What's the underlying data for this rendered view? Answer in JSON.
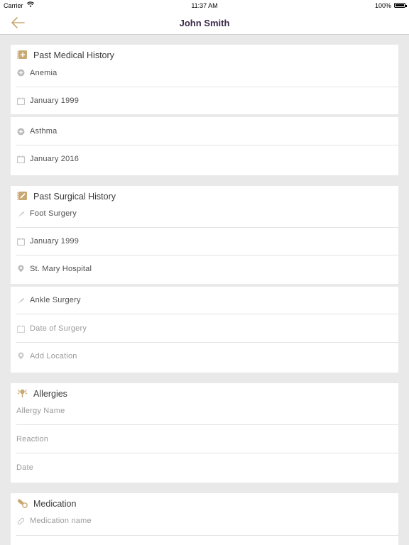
{
  "status_bar": {
    "carrier": "Carrier",
    "time": "11:37 AM",
    "battery": "100%"
  },
  "nav": {
    "title": "John Smith",
    "back_icon": "arrow-left-icon"
  },
  "colors": {
    "accent": "#c8a873",
    "title": "#3b2a4b",
    "background": "#e9e9e9"
  },
  "medical": {
    "title": "Past Medical History",
    "entries": [
      {
        "condition": "Anemia",
        "date": "January 1999"
      },
      {
        "condition": "Asthma",
        "date": "January 2016"
      }
    ]
  },
  "surgical": {
    "title": "Past Surgical History",
    "entries": [
      {
        "name": "Foot Surgery",
        "date": "January 1999",
        "location": "St. Mary Hospital"
      },
      {
        "name": "Ankle Surgery",
        "date_placeholder": "Date of Surgery",
        "location_placeholder": "Add Location"
      }
    ]
  },
  "allergies": {
    "title": "Allergies",
    "name_placeholder": "Allergy Name",
    "reaction_placeholder": "Reaction",
    "date_placeholder": "Date"
  },
  "medication": {
    "title": "Medication",
    "name_placeholder": "Medication name"
  }
}
